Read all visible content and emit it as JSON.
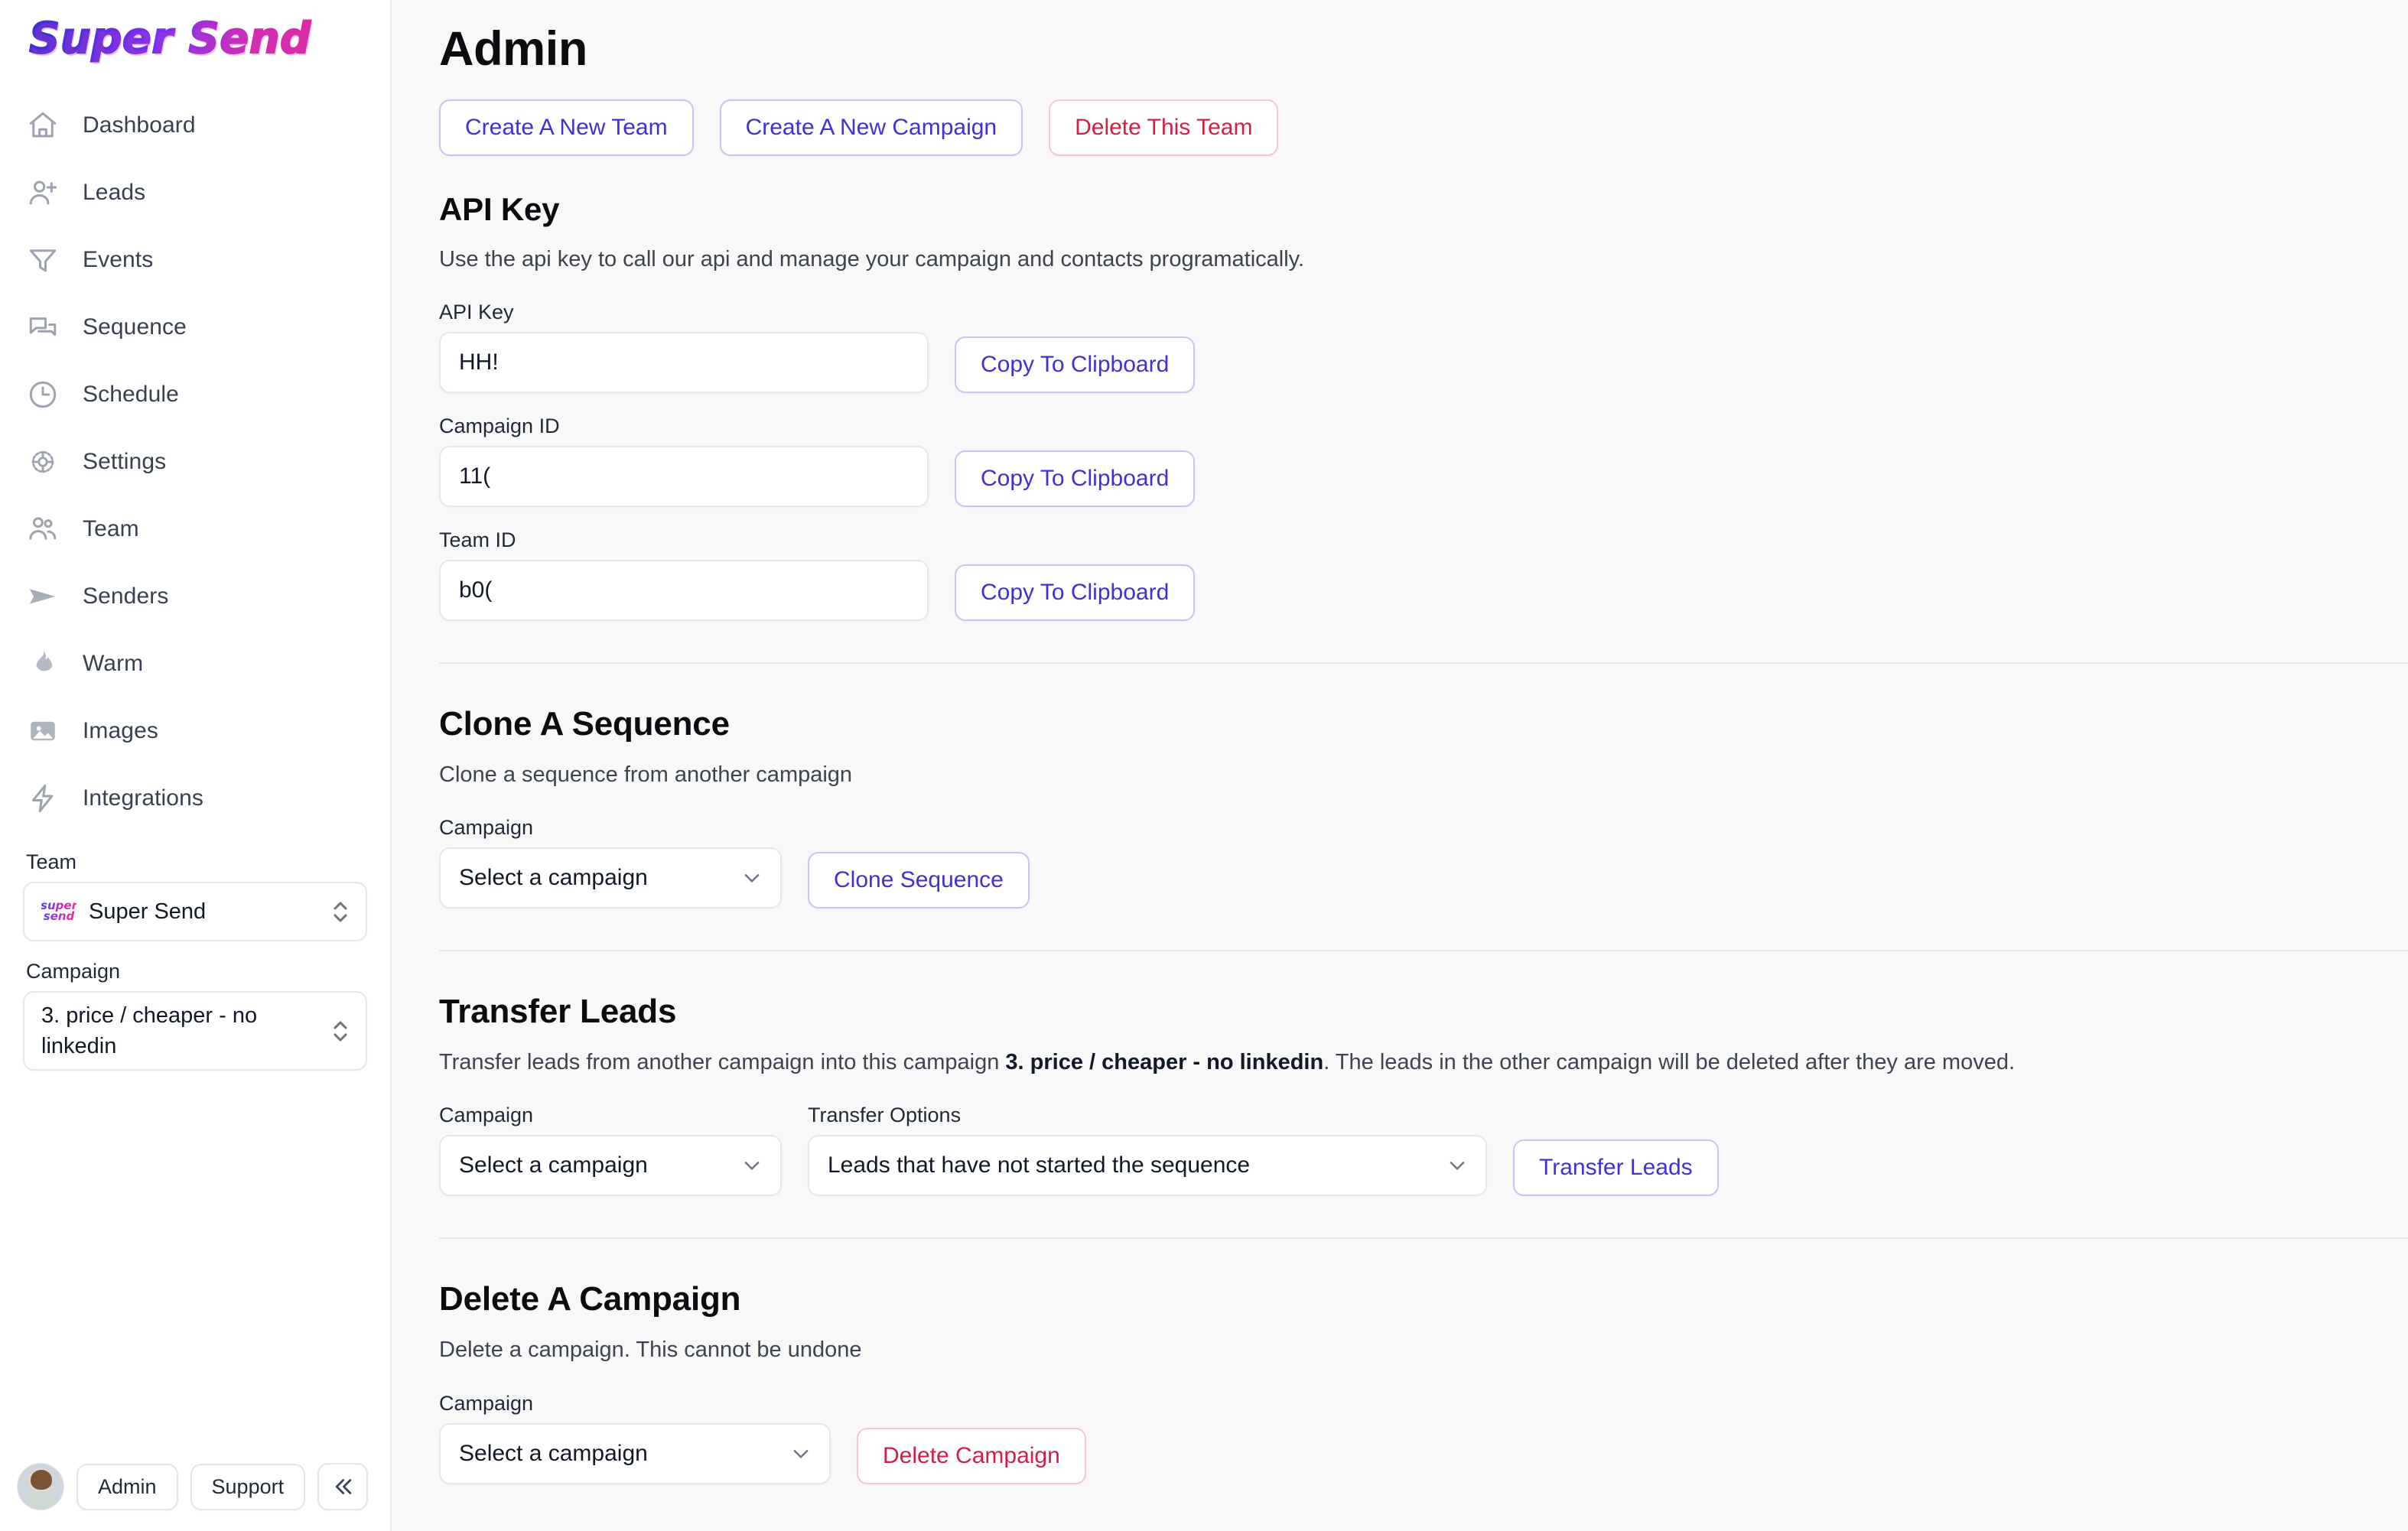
{
  "brand": {
    "logo_text": "Super Send",
    "badge_line1": "super",
    "badge_line2": "send"
  },
  "sidebar": {
    "items": [
      {
        "label": "Dashboard",
        "icon": "home-icon"
      },
      {
        "label": "Leads",
        "icon": "user-plus-icon"
      },
      {
        "label": "Events",
        "icon": "funnel-icon"
      },
      {
        "label": "Sequence",
        "icon": "chat-bubbles-icon"
      },
      {
        "label": "Schedule",
        "icon": "clock-icon"
      },
      {
        "label": "Settings",
        "icon": "gear-icon"
      },
      {
        "label": "Team",
        "icon": "users-icon"
      },
      {
        "label": "Senders",
        "icon": "paper-plane-icon"
      },
      {
        "label": "Warm",
        "icon": "flame-icon"
      },
      {
        "label": "Images",
        "icon": "image-icon"
      },
      {
        "label": "Integrations",
        "icon": "lightning-bolt-icon"
      }
    ],
    "team_picker": {
      "label": "Team",
      "value": "Super Send"
    },
    "campaign_picker": {
      "label": "Campaign",
      "value": "3. price / cheaper - no linkedin"
    },
    "footer": {
      "admin_label": "Admin",
      "support_label": "Support",
      "collapse_icon": "chevron-double-left-icon"
    }
  },
  "main": {
    "title": "Admin",
    "actions": [
      {
        "label": "Create A New Team",
        "style": "primary-outline"
      },
      {
        "label": "Create A New Campaign",
        "style": "primary-outline"
      },
      {
        "label": "Delete This Team",
        "style": "danger-outline"
      }
    ],
    "api_key_section": {
      "title": "API Key",
      "description": "Use the api key to call our api and manage your campaign and contacts programatically.",
      "fields": [
        {
          "label": "API Key",
          "value": "HH!",
          "button": "Copy To Clipboard"
        },
        {
          "label": "Campaign ID",
          "value": "11(",
          "button": "Copy To Clipboard"
        },
        {
          "label": "Team ID",
          "value": "b0(",
          "button": "Copy To Clipboard"
        }
      ]
    },
    "clone_section": {
      "title": "Clone A Sequence",
      "description": "Clone a sequence from another campaign",
      "campaign_label": "Campaign",
      "campaign_value": "Select a campaign",
      "button": "Clone Sequence"
    },
    "transfer_section": {
      "title": "Transfer Leads",
      "desc_before": "Transfer leads from another campaign into this campaign ",
      "desc_bold": "3. price / cheaper - no linkedin",
      "desc_after": ". The leads in the other campaign will be deleted after they are moved.",
      "campaign_label": "Campaign",
      "campaign_value": "Select a campaign",
      "options_label": "Transfer Options",
      "options_value": "Leads that have not started the sequence",
      "button": "Transfer Leads"
    },
    "delete_section": {
      "title": "Delete A Campaign",
      "description": "Delete a campaign. This cannot be undone",
      "campaign_label": "Campaign",
      "campaign_value": "Select a campaign",
      "button": "Delete Campaign"
    }
  },
  "colors": {
    "accent": "#3f31d6",
    "accent_border": "#c7c6f2",
    "danger": "#d21f45",
    "danger_border": "#f4c9d4",
    "page_bg": "#f8f8f9",
    "sidebar_bg": "#ffffff",
    "text": "#111827",
    "muted": "#3d4450"
  }
}
